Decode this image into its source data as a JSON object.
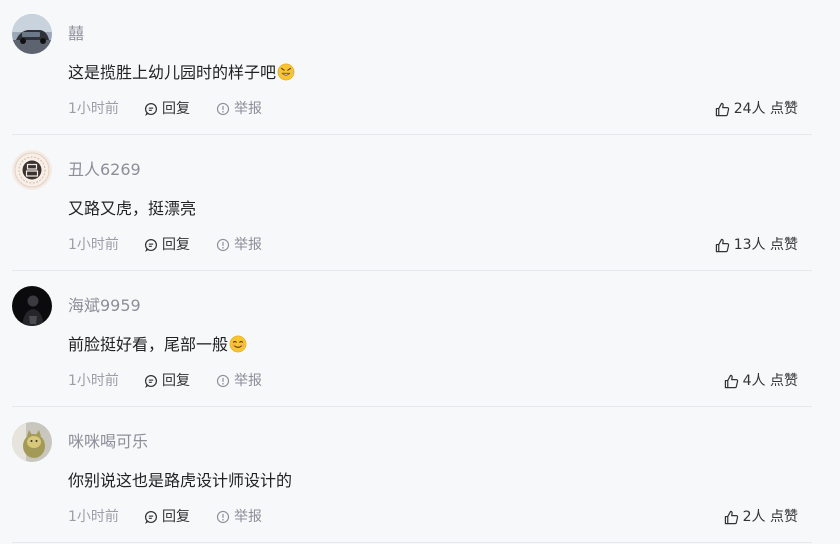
{
  "comments": [
    {
      "username": "囍",
      "text": "这是揽胜上幼儿园时的样子吧",
      "emoji": "rofl-emoji",
      "time": "1小时前",
      "reply_label": "回复",
      "report_label": "举报",
      "likes": "24人 点赞",
      "avatar": "car-photo"
    },
    {
      "username": "丑人6269",
      "text": "又路又虎，挺漂亮",
      "emoji": "",
      "time": "1小时前",
      "reply_label": "回复",
      "report_label": "举报",
      "likes": "13人 点赞",
      "avatar": "seal-badge"
    },
    {
      "username": "海斌9959",
      "text": "前脸挺好看，尾部一般",
      "emoji": "smile-emoji",
      "time": "1小时前",
      "reply_label": "回复",
      "report_label": "举报",
      "likes": "4人 点赞",
      "avatar": "dark-portrait"
    },
    {
      "username": "咪咪喝可乐",
      "text": "你别说这也是路虎设计师设计的",
      "emoji": "",
      "time": "1小时前",
      "reply_label": "回复",
      "report_label": "举报",
      "likes": "2人 点赞",
      "avatar": "cat-photo"
    }
  ]
}
